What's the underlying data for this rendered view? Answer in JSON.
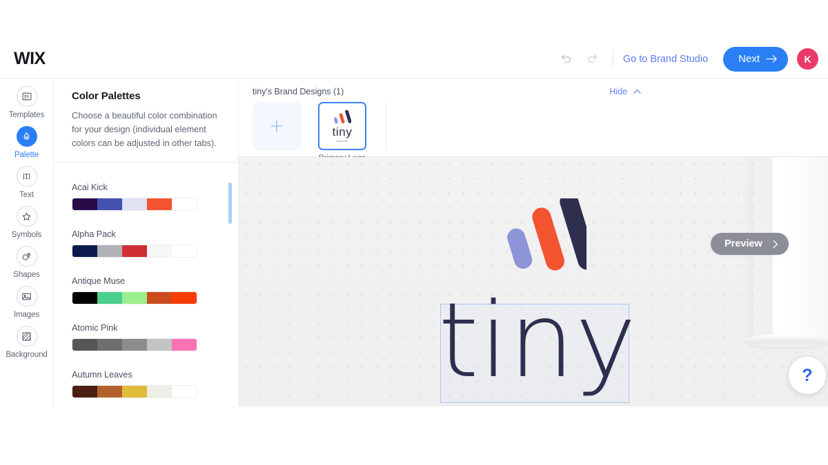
{
  "header": {
    "brand": "WIX",
    "undo_icon": "undo-icon",
    "redo_icon": "redo-icon",
    "brand_studio_link": "Go to Brand Studio",
    "next_label": "Next",
    "next_arrow": "arrow-right-icon",
    "avatar_initial": "K",
    "accent_blue": "#2b7ff5",
    "avatar_color": "#eb3a6a",
    "link_color": "#5b7bf2"
  },
  "rail": {
    "items": [
      {
        "label": "Templates",
        "icon": "templates-icon",
        "active": false
      },
      {
        "label": "Palette",
        "icon": "palette-icon",
        "active": true
      },
      {
        "label": "Text",
        "icon": "text-icon",
        "active": false
      },
      {
        "label": "Symbols",
        "icon": "star-icon",
        "active": false
      },
      {
        "label": "Shapes",
        "icon": "shapes-icon",
        "active": false
      },
      {
        "label": "Images",
        "icon": "image-icon",
        "active": false
      },
      {
        "label": "Background",
        "icon": "background-icon",
        "active": false
      }
    ]
  },
  "panel": {
    "title": "Color Palettes",
    "description": "Choose a beautiful color combination for your design (individual element colors can be adjusted in other tabs).",
    "scrollbar_color": "#a8d0f5",
    "palettes": [
      {
        "name": "Acai Kick",
        "colors": [
          "#2a0b4a",
          "#4450ad",
          "#dfe3f2",
          "#f4532f",
          "#ffffff"
        ]
      },
      {
        "name": "Alpha Pack",
        "colors": [
          "#0d1b4c",
          "#b0b2b5",
          "#d02f35",
          "#f6f6f6",
          "#ffffff"
        ]
      },
      {
        "name": "Antique Muse",
        "colors": [
          "#000000",
          "#4bcf8d",
          "#9bee8d",
          "#cc4a1c",
          "#f73c06"
        ]
      },
      {
        "name": "Atomic Pink",
        "colors": [
          "#565656",
          "#6e6e6e",
          "#8d8d8d",
          "#c4c4c4",
          "#fb73b4"
        ]
      },
      {
        "name": "Autumn Leaves",
        "colors": [
          "#4b1e13",
          "#b4622c",
          "#e1bb3a",
          "#eeefe4",
          "#ffffff"
        ]
      }
    ]
  },
  "designs": {
    "title": "tiny's Brand Designs (1)",
    "hide_label": "Hide",
    "hide_icon": "chevron-up-icon",
    "add_icon": "plus-icon",
    "cards": [
      {
        "word": "tiny",
        "sub": "fashion",
        "caption": "Primary Logo",
        "selected": true
      }
    ]
  },
  "canvas": {
    "logo_word": "tiny",
    "logo_mark_colors": [
      "#8d95d8",
      "#f4532f",
      "#2e2e4f"
    ],
    "logo_text_color": "#2e2e4f",
    "selection_border": "#a9c6f0",
    "preview_label": "Preview",
    "preview_arrow": "chevron-right-icon",
    "help_label": "?",
    "help_icon": "question-mark-icon"
  }
}
